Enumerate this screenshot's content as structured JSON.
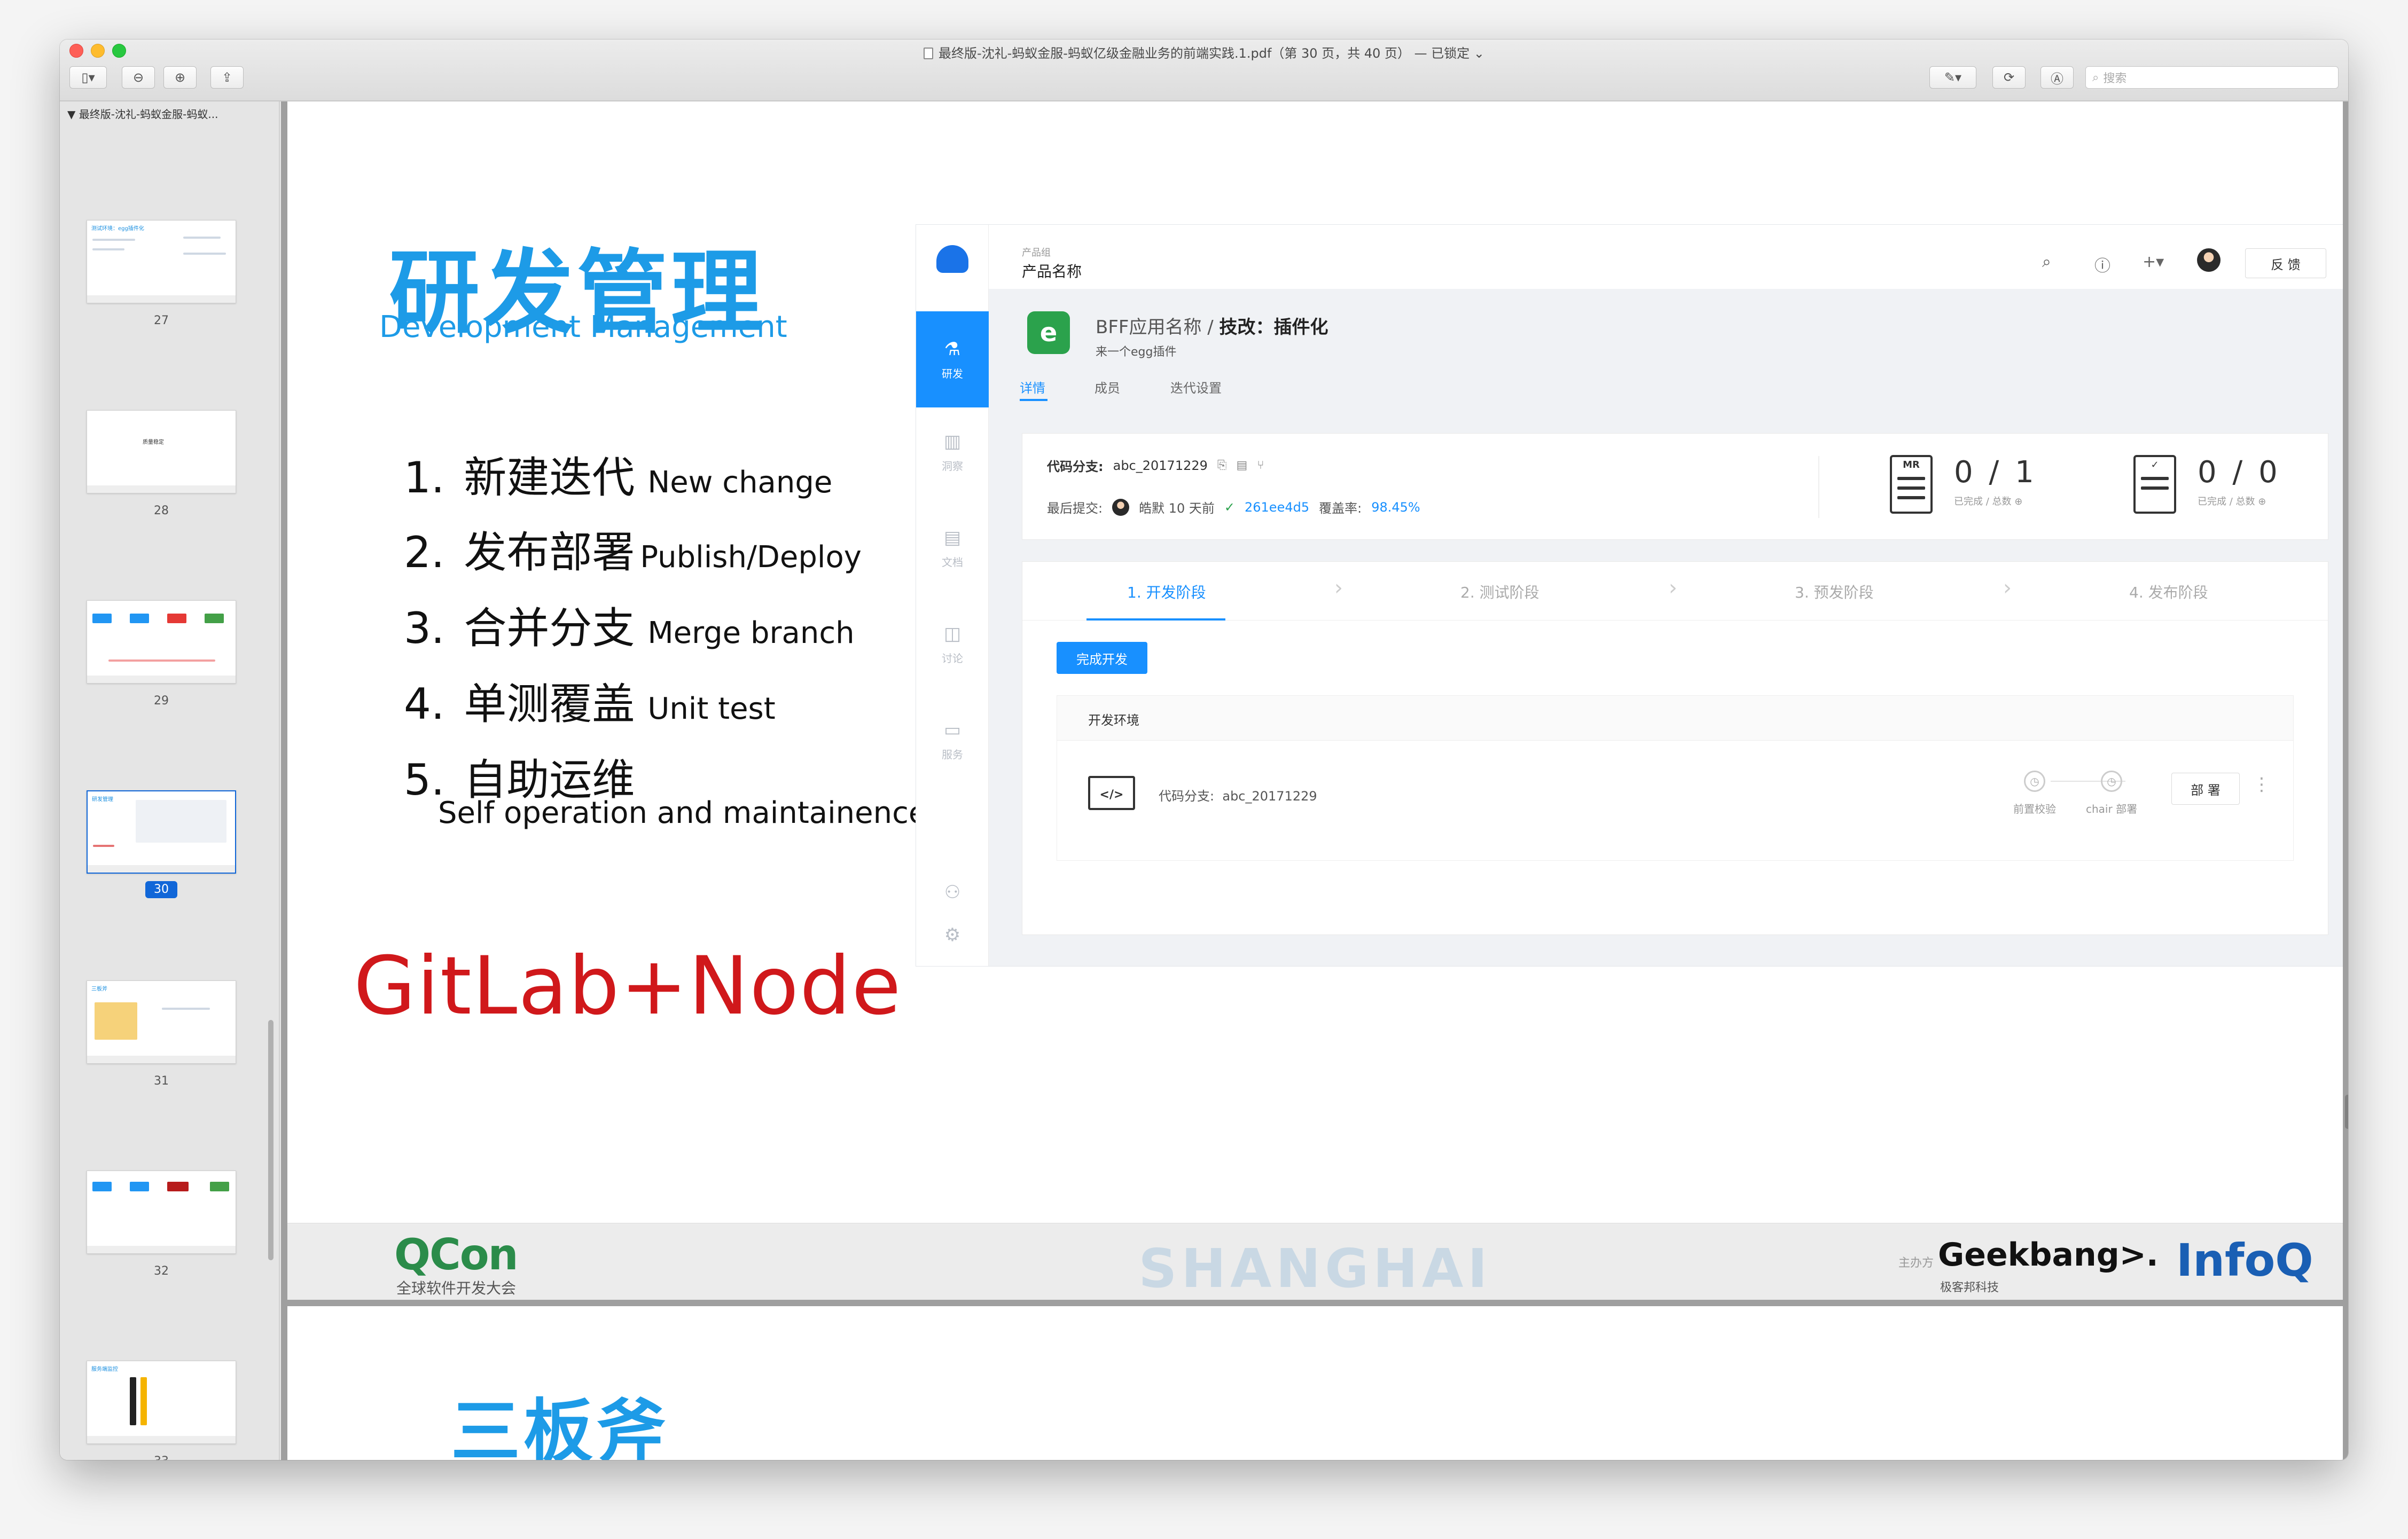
{
  "window": {
    "title": "最终版-沈礼-蚂蚁金服-蚂蚁亿级金融业务的前端实践.1.pdf（第 30 页，共 40 页） — 已锁定 ⌄",
    "search_placeholder": "搜索"
  },
  "sidebar": {
    "header": "▼  最终版-沈礼-蚂蚁金服-蚂蚁...",
    "pages": [
      "27",
      "28",
      "29",
      "30",
      "31",
      "32",
      "33"
    ],
    "current_page": "30",
    "thumb_titles": [
      "测试环境：egg插件化",
      "质量稳定",
      "",
      "研发管理",
      "三板斧",
      "",
      "服务端监控"
    ]
  },
  "slide": {
    "title": "研发管理",
    "subtitle": "Development Management",
    "items": [
      {
        "num": "1.",
        "cn": "新建迭代",
        "en": "New change"
      },
      {
        "num": "2.",
        "cn": "发布部署",
        "en": "Publish/Deploy"
      },
      {
        "num": "3.",
        "cn": "合并分支",
        "en": "Merge branch"
      },
      {
        "num": "4.",
        "cn": "单测覆盖",
        "en": "Unit test"
      },
      {
        "num": "5.",
        "cn": "自助运维",
        "en": ""
      }
    ],
    "item5_en": "Self operation and maintainence",
    "tagline": "GitLab+Node"
  },
  "app": {
    "nav": [
      {
        "icon": "⚗",
        "label": "研发"
      },
      {
        "icon": "▥",
        "label": "洞察"
      },
      {
        "icon": "▤",
        "label": "文档"
      },
      {
        "icon": "◫",
        "label": "讨论"
      },
      {
        "icon": "▭",
        "label": "服务"
      }
    ],
    "header": {
      "product_group": "产品组",
      "product_name": "产品名称",
      "feedback": "反 馈"
    },
    "project": {
      "name": "BFF应用名称",
      "separator": " / ",
      "change": "技改：插件化",
      "description": "来一个egg插件",
      "tabs": [
        "详情",
        "成员",
        "迭代设置"
      ]
    },
    "info": {
      "branch_label": "代码分支:",
      "branch_value": "abc_20171229",
      "commit_label": "最后提交:",
      "commit_author": "皓默 10 天前",
      "commit_hash": "261ee4d5",
      "coverage_label": "覆盖率:",
      "coverage_value": "98.45%",
      "mr_icon_label": "MR",
      "mr_stat": "0 / 1",
      "mr_caption": "已完成 / 总数 ⊕",
      "task_stat": "0 / 0",
      "task_caption": "已完成 / 总数 ⊕"
    },
    "stages": [
      "1.  开发阶段",
      "2.  测试阶段",
      "3.  预发阶段",
      "4.  发布阶段"
    ],
    "complete_button": "完成开发",
    "env": {
      "title": "开发环境",
      "branch_label": "代码分支:",
      "branch_value": "abc_20171229",
      "step1": "前置校验",
      "step2": "chair 部署",
      "deploy": "部 署"
    }
  },
  "footer": {
    "qcon": "QCon",
    "qcon_sub": "全球软件开发大会",
    "city": "SHANGHAI",
    "host_label": "主办方",
    "geekbang": "Geekbang>.",
    "geekbang_sub": "极客邦科技",
    "infoq": "InfoQ"
  },
  "next_slide": {
    "title": "三板斧"
  },
  "colors": {
    "accent": "#1890ff",
    "slide_title": "#1d9be7",
    "tagline": "#d0181b"
  }
}
